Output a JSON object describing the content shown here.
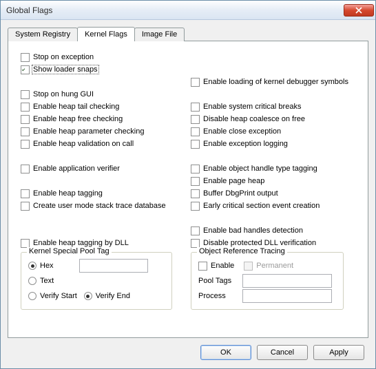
{
  "window": {
    "title": "Global Flags"
  },
  "tabs": {
    "system_registry": "System Registry",
    "kernel_flags": "Kernel Flags",
    "image_file": "Image File"
  },
  "active_tab": "kernel_flags",
  "left": {
    "stop_on_exception": "Stop on exception",
    "show_loader_snaps": "Show loader snaps",
    "stop_on_hung_gui": "Stop on hung GUI",
    "enable_heap_tail_checking": "Enable heap tail checking",
    "enable_heap_free_checking": "Enable heap free checking",
    "enable_heap_parameter_checking": "Enable heap parameter checking",
    "enable_heap_validation_on_call": "Enable heap validation on call",
    "enable_application_verifier": "Enable application verifier",
    "enable_heap_tagging": "Enable heap tagging",
    "create_user_mode_stack_trace": "Create user mode stack trace database",
    "enable_heap_tagging_by_dll": "Enable heap tagging by DLL"
  },
  "right": {
    "enable_loading_kernel_dbg_symbols": "Enable loading of kernel debugger symbols",
    "enable_system_critical_breaks": "Enable system critical breaks",
    "disable_heap_coalesce_on_free": "Disable heap coalesce on free",
    "enable_close_exception": "Enable close exception",
    "enable_exception_logging": "Enable exception logging",
    "enable_object_handle_type_tagging": "Enable object handle type tagging",
    "enable_page_heap": "Enable page heap",
    "buffer_dbgprint_output": "Buffer DbgPrint output",
    "early_critical_section_event": "Early critical section event creation",
    "enable_bad_handles_detection": "Enable bad handles detection",
    "disable_protected_dll_verification": "Disable protected DLL verification"
  },
  "checked": {
    "show_loader_snaps": true
  },
  "kernel_special_pool_tag": {
    "legend": "Kernel Special Pool Tag",
    "hex": "Hex",
    "text": "Text",
    "verify_start": "Verify Start",
    "verify_end": "Verify End",
    "input_value": "",
    "selected_format": "hex",
    "selected_verify": "verify_end"
  },
  "object_reference_tracing": {
    "legend": "Object Reference Tracing",
    "enable": "Enable",
    "permanent": "Permanent",
    "pool_tags_label": "Pool Tags",
    "process_label": "Process",
    "pool_tags_value": "",
    "process_value": ""
  },
  "buttons": {
    "ok": "OK",
    "cancel": "Cancel",
    "apply": "Apply"
  }
}
